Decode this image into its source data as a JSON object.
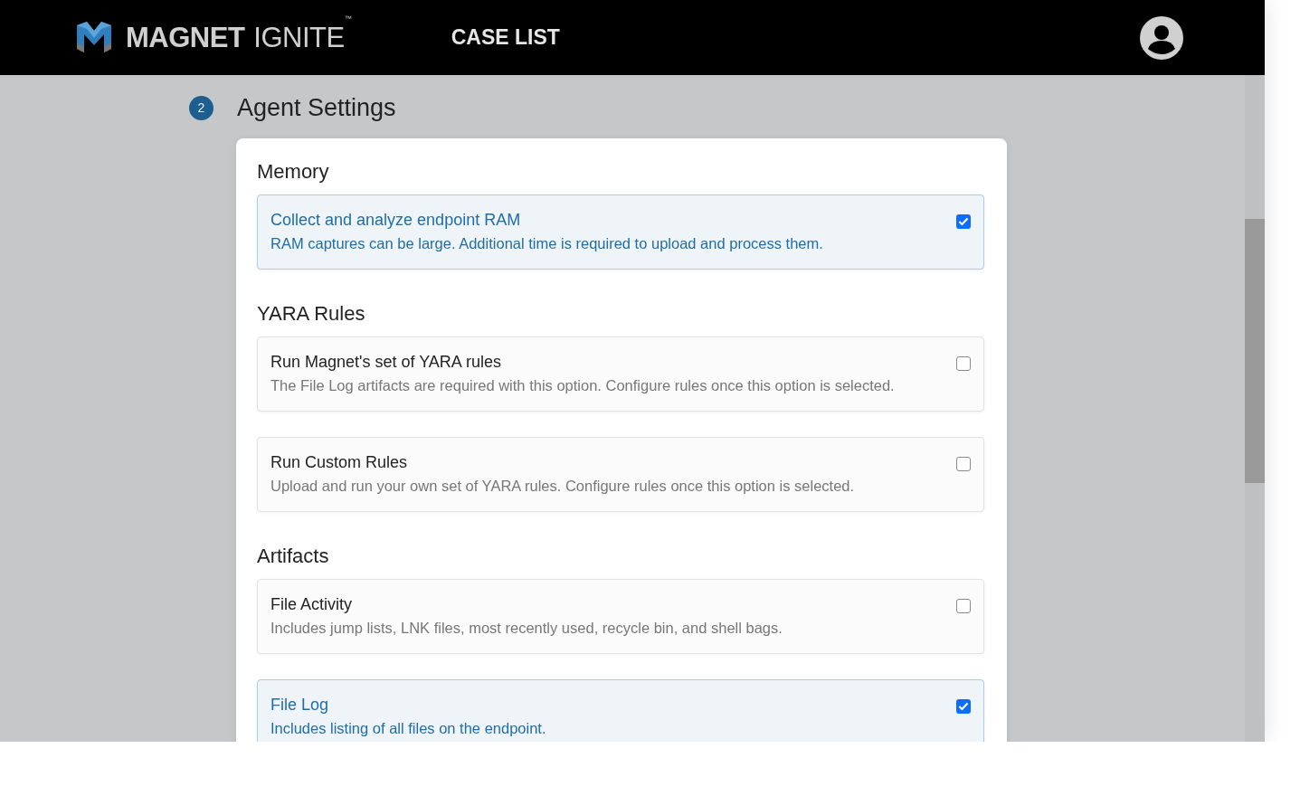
{
  "header": {
    "logo": {
      "brand": "MAGNET",
      "product": "IGNITE",
      "mark": "™"
    },
    "nav": [
      {
        "label": "CASE LIST"
      }
    ]
  },
  "step": {
    "number": "2",
    "title": "Agent Settings"
  },
  "sections": [
    {
      "title": "Memory",
      "options": [
        {
          "title": "Collect and analyze endpoint RAM",
          "description": "RAM captures can be large. Additional time is required to upload and process them.",
          "checked": true
        }
      ]
    },
    {
      "title": "YARA Rules",
      "options": [
        {
          "title": "Run Magnet's set of YARA rules",
          "description": "The File Log artifacts are required with this option. Configure rules once this option is selected.",
          "checked": false
        },
        {
          "title": "Run Custom Rules",
          "description": "Upload and run your own set of YARA rules. Configure rules once this option is selected.",
          "checked": false
        }
      ]
    },
    {
      "title": "Artifacts",
      "options": [
        {
          "title": "File Activity",
          "description": "Includes jump lists, LNK files, most recently used, recycle bin, and shell bags.",
          "checked": false
        },
        {
          "title": "File Log",
          "description": "Includes listing of all files on the endpoint.",
          "checked": true
        }
      ]
    }
  ]
}
